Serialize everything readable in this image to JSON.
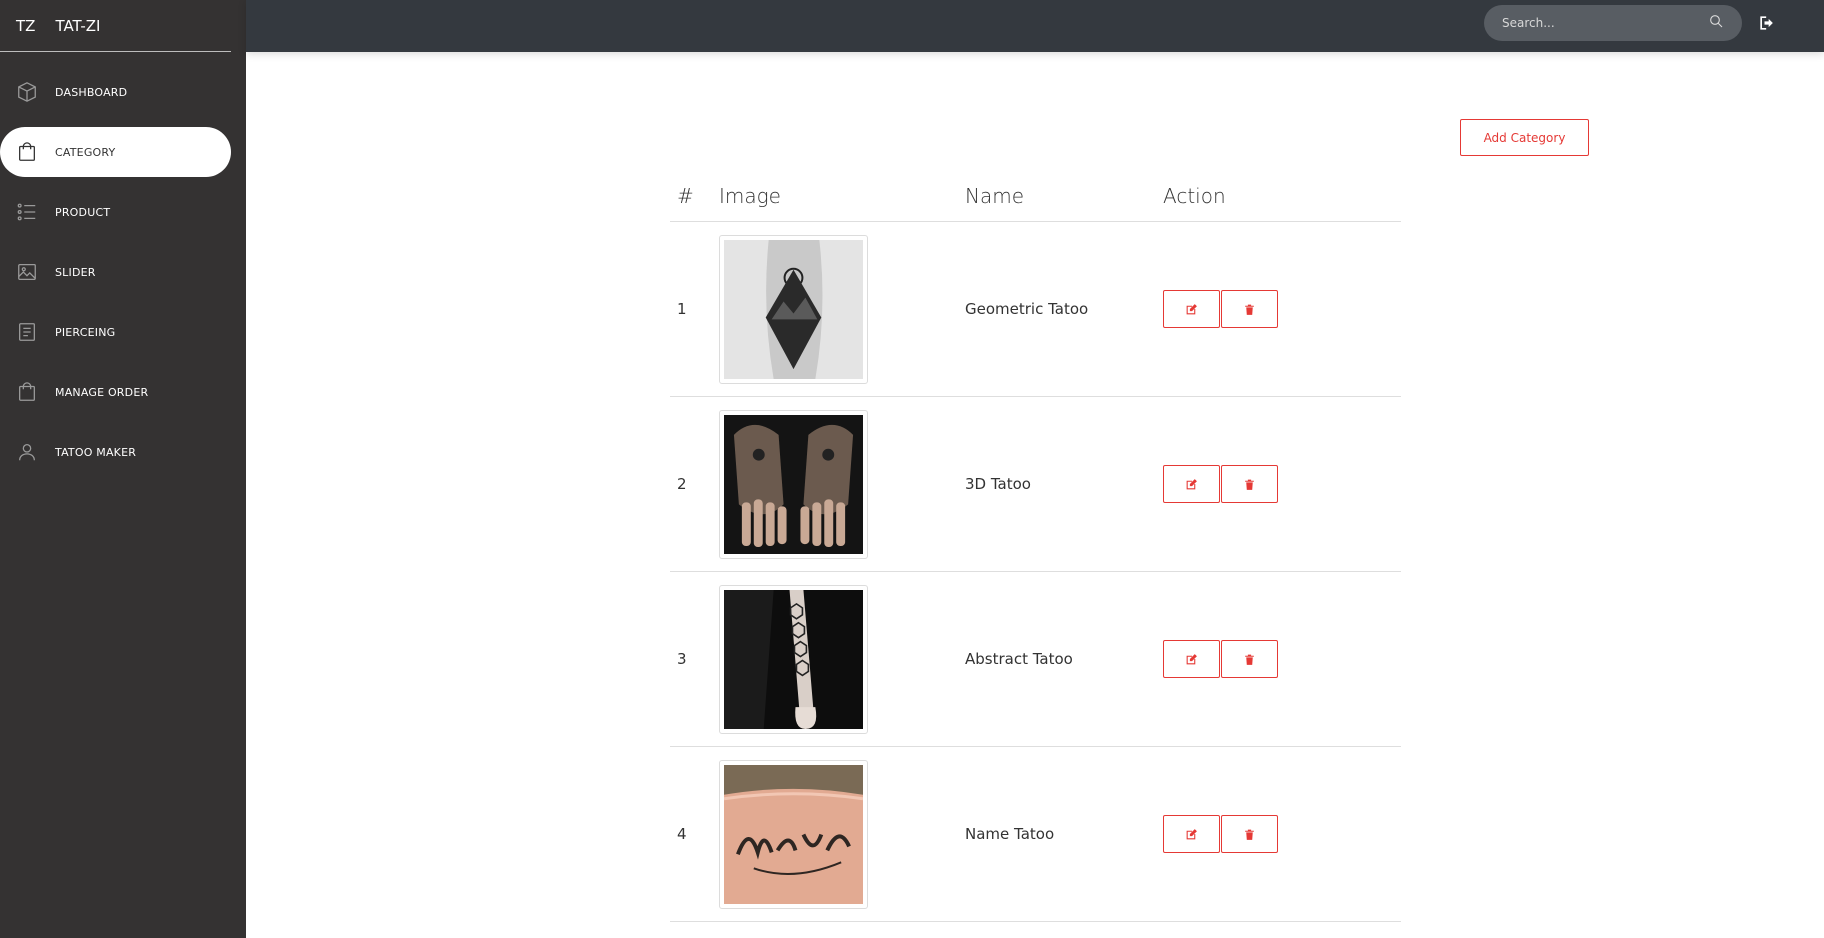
{
  "brand": {
    "abbr": "TZ",
    "name": "TAT-ZI"
  },
  "sidebar": {
    "items": [
      {
        "label": "DASHBOARD",
        "icon": "cube-icon"
      },
      {
        "label": "CATEGORY",
        "icon": "shopping-bag-icon",
        "active": true
      },
      {
        "label": "PRODUCT",
        "icon": "list-icon"
      },
      {
        "label": "SLIDER",
        "icon": "image-icon"
      },
      {
        "label": "PIERCEING",
        "icon": "document-icon"
      },
      {
        "label": "MANAGE ORDER",
        "icon": "shopping-bag-icon"
      },
      {
        "label": "TATOO MAKER",
        "icon": "user-icon"
      }
    ]
  },
  "topbar": {
    "search_placeholder": "Search...",
    "search_icon": "search-icon",
    "logout_icon": "logout-icon"
  },
  "main": {
    "add_button": "Add Category",
    "table": {
      "headers": [
        "#",
        "Image",
        "Name",
        "Action"
      ],
      "rows": [
        {
          "num": "1",
          "name": "Geometric Tatoo"
        },
        {
          "num": "2",
          "name": "3D Tatoo"
        },
        {
          "num": "3",
          "name": "Abstract Tatoo"
        },
        {
          "num": "4",
          "name": "Name Tatoo"
        }
      ]
    }
  },
  "colors": {
    "accent": "#e53935",
    "sidebar_bg": "#343232",
    "topbar_bg": "#34393f"
  }
}
